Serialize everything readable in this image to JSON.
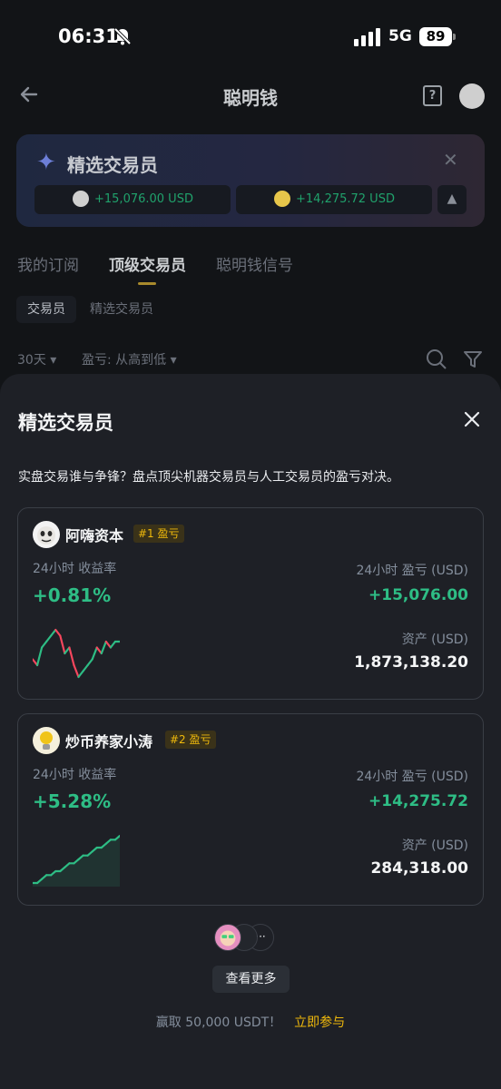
{
  "status_bar": {
    "time": "06:31",
    "network": "5G",
    "battery": "89"
  },
  "page": {
    "title": "聪明钱",
    "help_icon_text": "?",
    "banner": {
      "title": "精选交易员",
      "pill_a": "+15,076.00 USD",
      "pill_b": "+14,275.72 USD"
    },
    "tabs": [
      "我的订阅",
      "顶级交易员",
      "聪明钱信号"
    ],
    "subtabs": [
      "交易员",
      "精选交易员"
    ],
    "filters": {
      "period": "30天",
      "sort": "盈亏: 从高到低"
    }
  },
  "sheet": {
    "title": "精选交易员",
    "description": "实盘交易谁与争锋？盘点顶尖机器交易员与人工交易员的盈亏对决。",
    "traders": [
      {
        "name": "阿嗨资本",
        "rank_badge": "#1 盈亏",
        "roi_label": "24小时 收益率",
        "roi": "+0.81%",
        "pnl_label": "24小时 盈亏 (USD)",
        "pnl": "+15,076.00",
        "asset_label": "资产 (USD)",
        "asset": "1,873,138.20"
      },
      {
        "name": "炒币养家小涛",
        "rank_badge": "#2 盈亏",
        "roi_label": "24小时 收益率",
        "roi": "+5.28%",
        "pnl_label": "24小时 盈亏 (USD)",
        "pnl": "+14,275.72",
        "asset_label": "资产 (USD)",
        "asset": "284,318.00"
      }
    ],
    "more_dots": "···",
    "view_more_label": "查看更多",
    "footer_text": "赢取 50,000 USDT！",
    "footer_link": "立即参与"
  },
  "colors": {
    "up": "#2ebd85",
    "down": "#f6465d",
    "accent": "#f0b90b",
    "sheet_bg": "#1e2026"
  },
  "chart_data": [
    {
      "type": "line",
      "series": [
        {
          "values": [
            3,
            2,
            5,
            6,
            7,
            8,
            7,
            4,
            5,
            2,
            0,
            1,
            2,
            3,
            5,
            4,
            6,
            5,
            6,
            6
          ]
        }
      ]
    },
    {
      "type": "area",
      "series": [
        {
          "values": [
            0,
            0,
            1,
            2,
            2,
            3,
            3,
            4,
            5,
            5,
            6,
            7,
            7,
            8,
            9,
            9,
            10,
            11,
            11,
            12
          ]
        }
      ]
    }
  ]
}
